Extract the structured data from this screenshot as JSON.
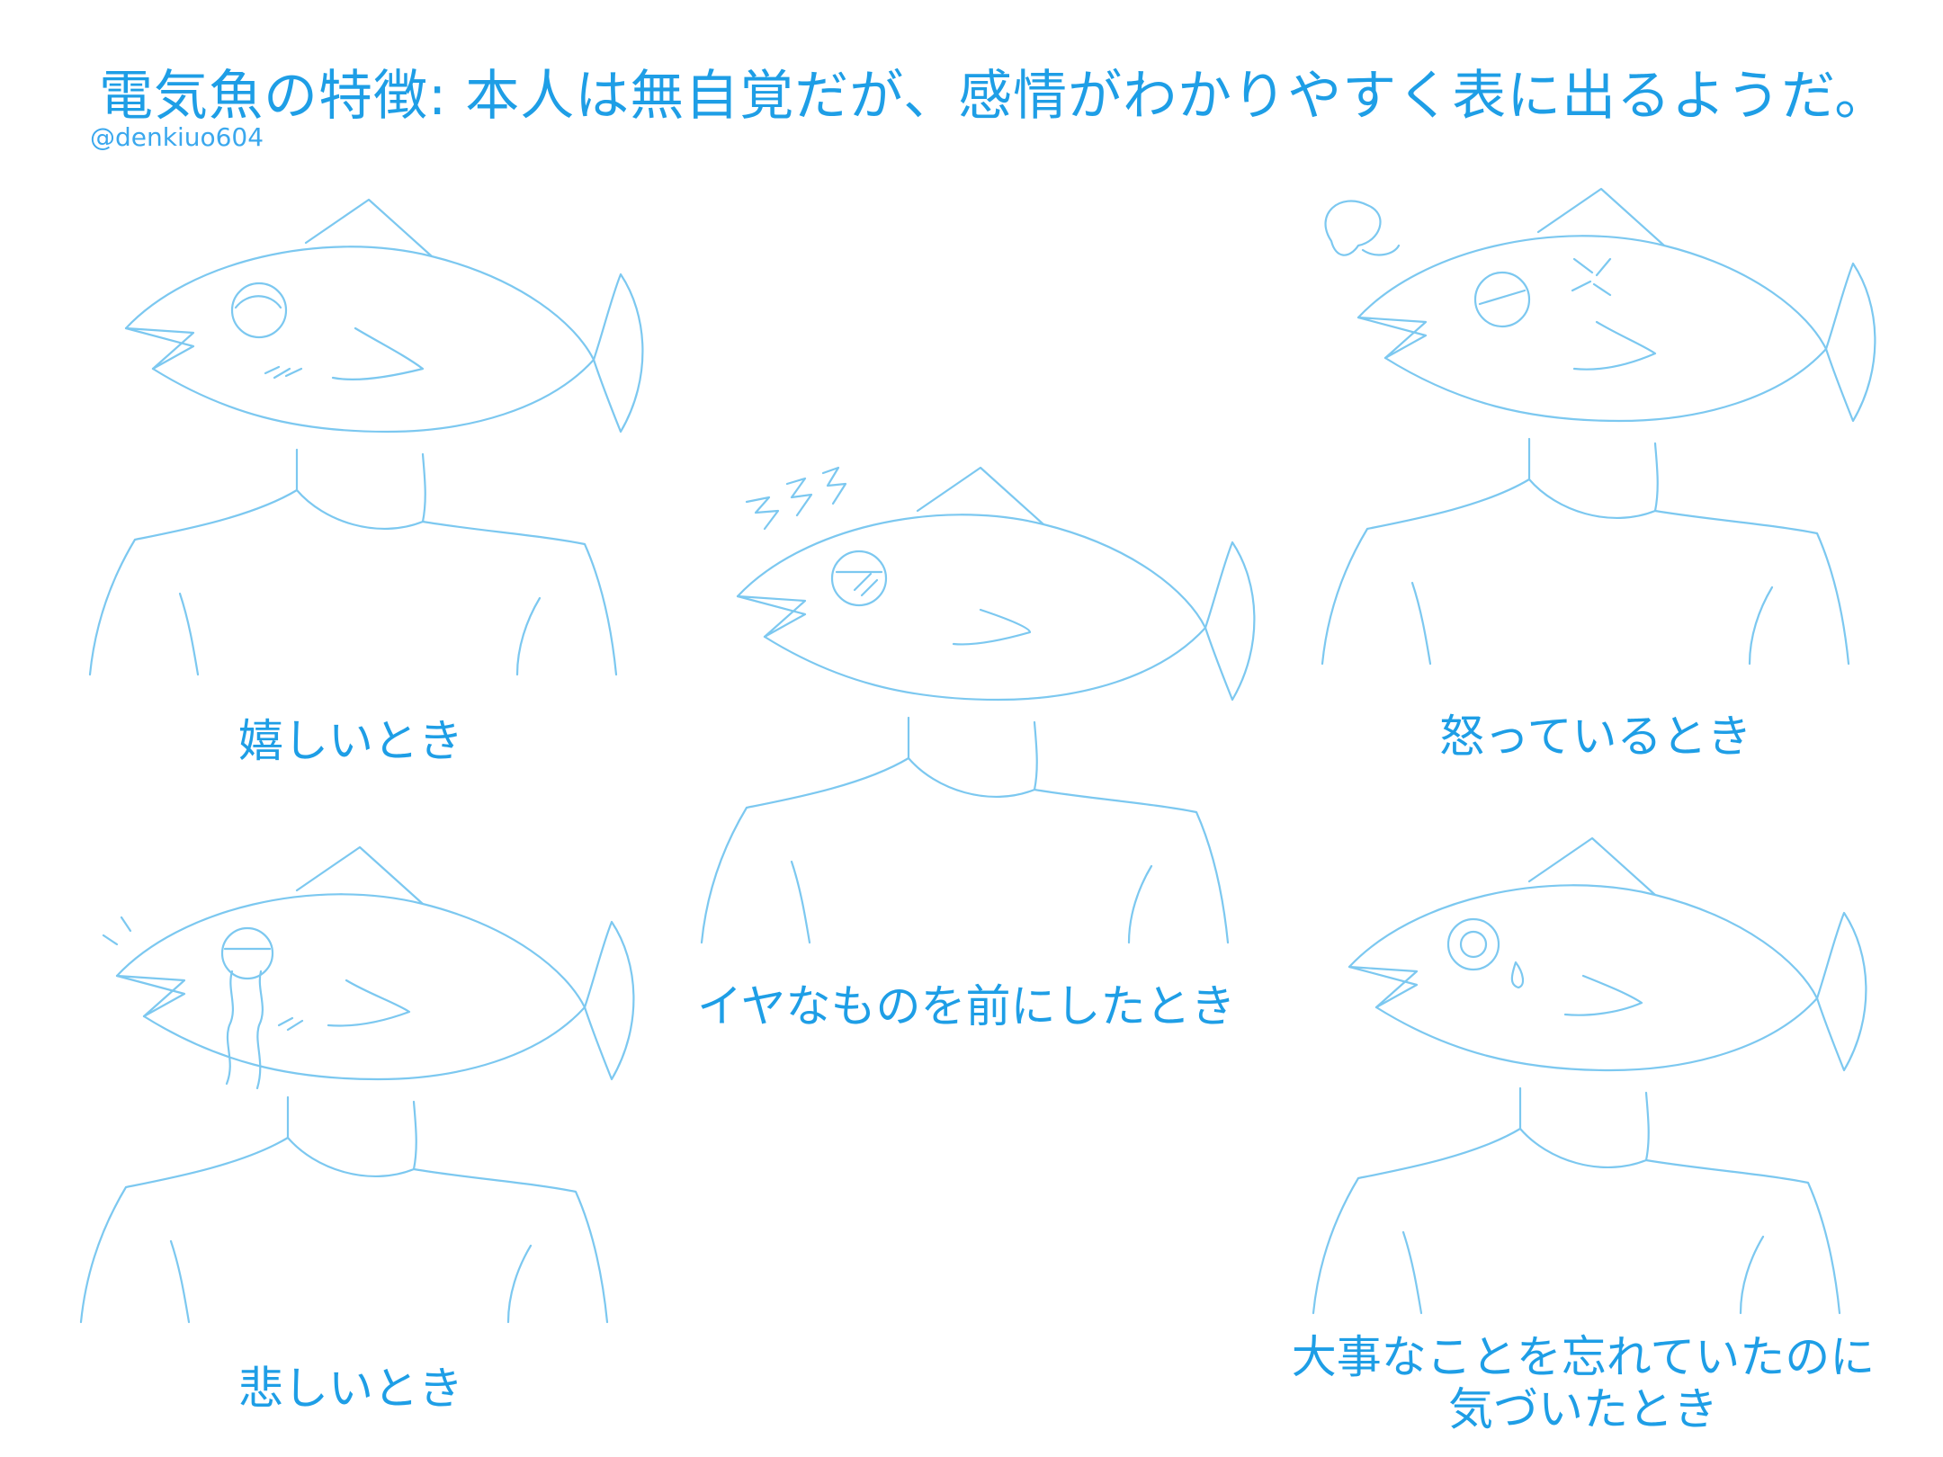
{
  "title": "電気魚の特徴: 本人は無自覚だが、感情がわかりやすく表に出るようだ。",
  "author": "@denkiuo604",
  "captions": {
    "happy": "嬉しいとき",
    "disgust": "イヤなものを前にしたとき",
    "angry": "怒っているとき",
    "sad": "悲しいとき",
    "notice_line1": "大事なことを忘れていたのに",
    "notice_line2": "気づいたとき"
  },
  "colors": {
    "text": "#1e9ee6",
    "line": "#7cc8f0",
    "background": "#ffffff"
  }
}
